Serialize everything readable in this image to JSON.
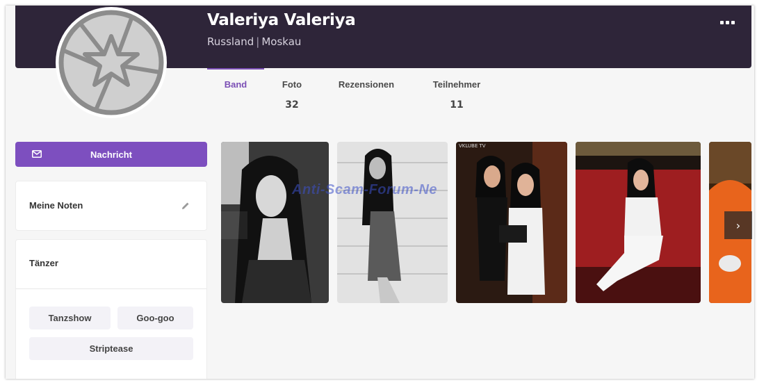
{
  "profile": {
    "name": "Valeriya Valeriya",
    "country": "Russland",
    "separator": "|",
    "city": "Moskau"
  },
  "tabs": [
    {
      "label": "Band",
      "count": ""
    },
    {
      "label": "Foto",
      "count": "32"
    },
    {
      "label": "Rezensionen",
      "count": ""
    },
    {
      "label": "Teilnehmer",
      "count": "11"
    }
  ],
  "sidebar": {
    "message_label": "Nachricht",
    "notes_title": "Meine Noten",
    "dancer_title": "Tänzer",
    "tags": [
      "Tanzshow",
      "Goo-goo",
      "Striptease"
    ]
  },
  "gallery": {
    "watermark": "Anti-Scam-Forum-Ne",
    "photo_overlay_text": "VKLUBE TV",
    "next_arrow": "›"
  },
  "colors": {
    "header_bg": "#2e2539",
    "accent": "#7d4fbf",
    "page_bg": "#f6f6f6"
  },
  "icons": [
    "star-avatar-icon",
    "more-icon",
    "mail-icon",
    "pencil-icon",
    "chevron-left-icon",
    "chevron-right-icon"
  ]
}
